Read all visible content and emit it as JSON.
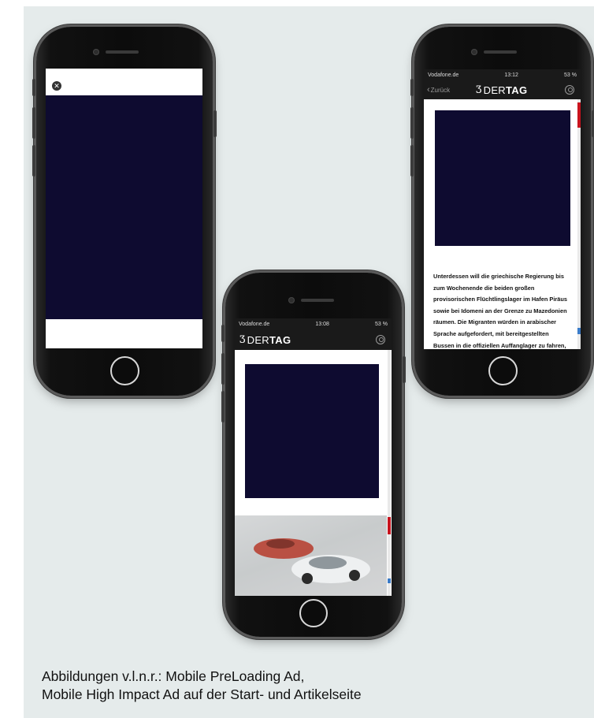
{
  "phone_left": {
    "close_icon": "close-circle-icon"
  },
  "phone_middle": {
    "status": {
      "carrier": "Vodafone.de",
      "time": "13:08",
      "battery": "53 %"
    },
    "logo": {
      "prefix": "DER",
      "suffix": "TAG"
    },
    "icons": {
      "user": "user-circle-icon"
    }
  },
  "phone_right": {
    "status": {
      "carrier": "Vodafone.de",
      "time": "13:12",
      "battery": "53 %"
    },
    "back_label": "Zurück",
    "logo": {
      "prefix": "DER",
      "suffix": "TAG"
    },
    "icons": {
      "back": "chevron-left-icon",
      "user": "user-circle-icon"
    },
    "article_lines": [
      "Unterdessen will die griechische Regierung bis",
      "zum Wochenende die beiden großen",
      "provisorischen Flüchtlingslager im Hafen Piräus",
      "sowie bei Idomeni an der Grenze zu Mazedonien",
      "räumen. Die Migranten würden in arabischer",
      "Sprache aufgefordert, mit bereitgestellten",
      "Bussen in die offiziellen Auffanglager zu fahren,"
    ]
  },
  "caption": {
    "line1": "Abbildungen v.l.n.r.: Mobile PreLoading Ad,",
    "line2": "Mobile High Impact Ad auf der Start- und Artikelseite"
  },
  "colors": {
    "panel_bg": "#e5ebeb",
    "ad_fill": "#0e0b30",
    "accent_red": "#c8141e",
    "app_bar": "#1a1a1a"
  }
}
